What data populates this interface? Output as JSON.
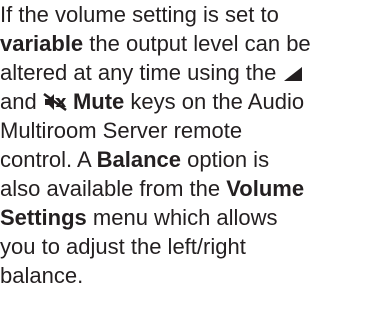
{
  "paragraph": {
    "l1": "If the volume setting is set to",
    "l2_bold": "variable",
    "l2_rest": " the output level can be",
    "l3_pre": "altered at any time using the",
    "l3_icon": "volume-up-icon",
    "l4_pre": "and ",
    "l4_icon": "mute-icon",
    "l4_bold": "Mute",
    "l4_rest": " keys on the Audio",
    "l5": "Multiroom Server remote",
    "l6_pre": "control.  A ",
    "l6_bold": "Balance",
    "l6_rest": " option is",
    "l7_pre": "also available from the ",
    "l7_bold": "Volume",
    "l8_bold": "Settings",
    "l8_rest": " menu which allows",
    "l9": "you to adjust the left/right",
    "l10": "balance."
  }
}
